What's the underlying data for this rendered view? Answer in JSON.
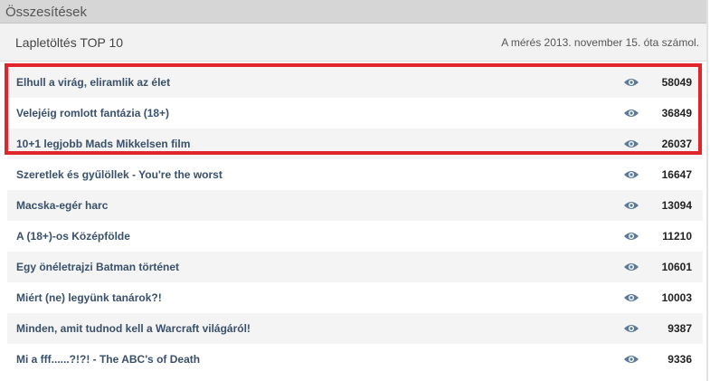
{
  "panel": {
    "title": "Összesítések",
    "subtitle": "Lapletöltés TOP 10",
    "note": "A mérés 2013. november 15. óta számol."
  },
  "colors": {
    "header_bg": "#d6d6d6",
    "link": "#39506b",
    "eye_icon": "#5b7a99",
    "highlight": "#e0252b"
  },
  "items": [
    {
      "title": "Elhull a virág, eliramlik az élet",
      "views": "58049",
      "icon": "eye-icon"
    },
    {
      "title": "Velejéig romlott fantázia (18+)",
      "views": "36849",
      "icon": "eye-icon"
    },
    {
      "title": "10+1 legjobb Mads Mikkelsen film",
      "views": "26037",
      "icon": "eye-icon"
    },
    {
      "title": "Szeretlek és gyűlöllek - You're the worst",
      "views": "16647",
      "icon": "eye-icon"
    },
    {
      "title": "Macska-egér harc",
      "views": "13094",
      "icon": "eye-icon"
    },
    {
      "title": "A (18+)-os Középfölde",
      "views": "11210",
      "icon": "eye-icon"
    },
    {
      "title": "Egy önéletrajzi Batman történet",
      "views": "10601",
      "icon": "eye-icon"
    },
    {
      "title": "Miért (ne) legyünk tanárok?!",
      "views": "10003",
      "icon": "eye-icon"
    },
    {
      "title": "Minden, amit tudnod kell a Warcraft világáról!",
      "views": "9387",
      "icon": "eye-icon"
    },
    {
      "title": "Mi a fff......?!?! - The ABC's of Death",
      "views": "9336",
      "icon": "eye-icon"
    }
  ]
}
